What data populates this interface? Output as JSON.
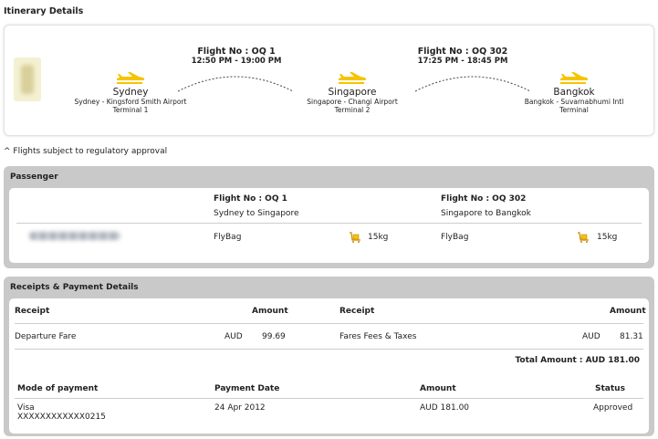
{
  "itinerary": {
    "title": "Itinerary Details",
    "note": "^ Flights subject to regulatory approval",
    "cities": [
      {
        "name": "Sydney",
        "airport": "Sydney - Kingsford Smith Airport",
        "terminal": "Terminal 1"
      },
      {
        "name": "Singapore",
        "airport": "Singapore - Changi Airport",
        "terminal": "Terminal 2"
      },
      {
        "name": "Bangkok",
        "airport": "Bangkok - Suvarnabhumi Intl",
        "terminal": "Terminal"
      }
    ],
    "flights": [
      {
        "number": "Flight No : OQ 1",
        "time": "12:50 PM - 19:00 PM"
      },
      {
        "number": "Flight No : OQ 302",
        "time": "17:25 PM - 18:45 PM"
      }
    ]
  },
  "passenger": {
    "title": "Passenger",
    "flights": [
      {
        "number": "Flight No : OQ 1",
        "route": "Sydney to Singapore",
        "bag_label": "FlyBag",
        "bag_weight": "15kg"
      },
      {
        "number": "Flight No : OQ 302",
        "route": "Singapore to Bangkok",
        "bag_label": "FlyBag",
        "bag_weight": "15kg"
      }
    ],
    "bag_icon": "luggage-cart-icon"
  },
  "receipts": {
    "title": "Receipts & Payment Details",
    "headers": {
      "receipt": "Receipt",
      "amount": "Amount"
    },
    "items": [
      {
        "label": "Departure Fare",
        "currency": "AUD",
        "amount": "99.69"
      },
      {
        "label": "Fares Fees & Taxes",
        "currency": "AUD",
        "amount": "81.31"
      }
    ],
    "total": "Total Amount : AUD 181.00",
    "payment_headers": {
      "mode": "Mode of payment",
      "date": "Payment Date",
      "amount": "Amount",
      "status": "Status"
    },
    "payment": {
      "mode": "Visa",
      "card": "XXXXXXXXXXXX0215",
      "date": "24 Apr 2012",
      "amount": "AUD 181.00",
      "status": "Approved"
    }
  },
  "colors": {
    "plane": "#f5c400",
    "panel": "#c9c9c9"
  }
}
